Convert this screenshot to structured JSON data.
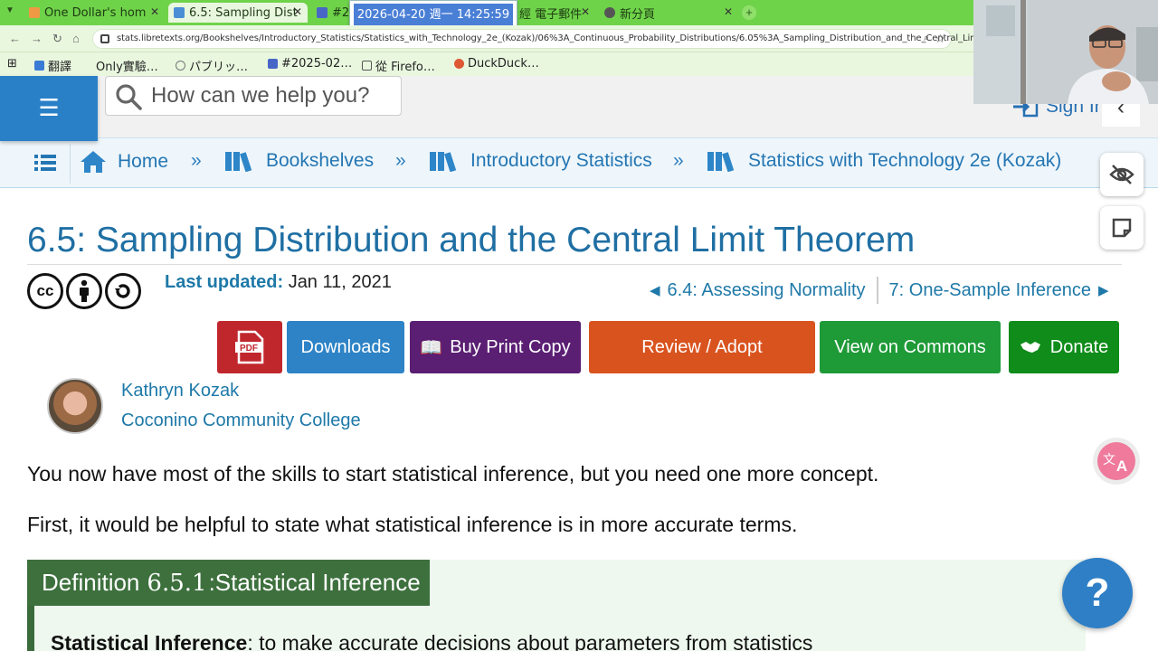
{
  "browser": {
    "tabs": [
      {
        "label": "One Dollar's hom",
        "active": false
      },
      {
        "label": "6.5: Sampling Dist",
        "active": true
      },
      {
        "label": "#20",
        "active": false
      },
      {
        "label": "經 電子郵件",
        "active": false
      },
      {
        "label": "新分頁",
        "active": false
      }
    ],
    "clock": "2026-04-20 週一 14:25:59",
    "url": "stats.libretexts.org/Bookshelves/Introductory_Statistics/Statistics_with_Technology_2e_(Kozak)/06%3A_Continuous_Probability_Distributions/6.05%3A_Sampling_Distribution_and_the_Central_Limit_Theorem",
    "bookmarks": [
      "翻譯",
      "Only實驗…",
      "パブリッ…",
      "#2025-02…",
      "從 Firefo…",
      "DuckDuck…"
    ]
  },
  "header": {
    "search_placeholder": "How can we help you?",
    "signin": "Sign In"
  },
  "breadcrumb": [
    "Home",
    "Bookshelves",
    "Introductory Statistics",
    "Statistics with Technology 2e (Kozak)"
  ],
  "breadcrumb_sep": "»",
  "page": {
    "title": "6.5: Sampling Distribution and the Central Limit Theorem",
    "updated_label": "Last updated:",
    "updated_value": "Jan 11, 2021",
    "prev": "6.4: Assessing Normality",
    "next": "7: One-Sample Inference",
    "license_icons": [
      "cc-icon",
      "by-icon",
      "sa-icon"
    ],
    "license_cc_text": "cc"
  },
  "actions": {
    "pdf": "PDF",
    "downloads": "Downloads",
    "buy": "Buy Print Copy",
    "review": "Review / Adopt",
    "commons": "View on Commons",
    "donate": "Donate"
  },
  "colors": {
    "pdf": "#c0272d",
    "downloads": "#2d83c6",
    "buy": "#5a1e73",
    "review": "#d9531e",
    "commons": "#1e9a37",
    "donate": "#0f8c1a",
    "brand": "#2980c7"
  },
  "author": {
    "name": "Kathryn Kozak",
    "org": "Coconino Community College"
  },
  "content": {
    "p1": "You now have most of the skills to start statistical inference, but you need one more concept.",
    "p2": "First, it would be helpful to state what statistical inference is in more accurate terms.",
    "def_prefix": "Definition",
    "def_number": "6.5.1",
    "def_title": ":Statistical Inference",
    "def_term": "Statistical Inference",
    "def_body": ": to make accurate decisions about parameters from statistics"
  },
  "widgets": {
    "help": "?"
  }
}
